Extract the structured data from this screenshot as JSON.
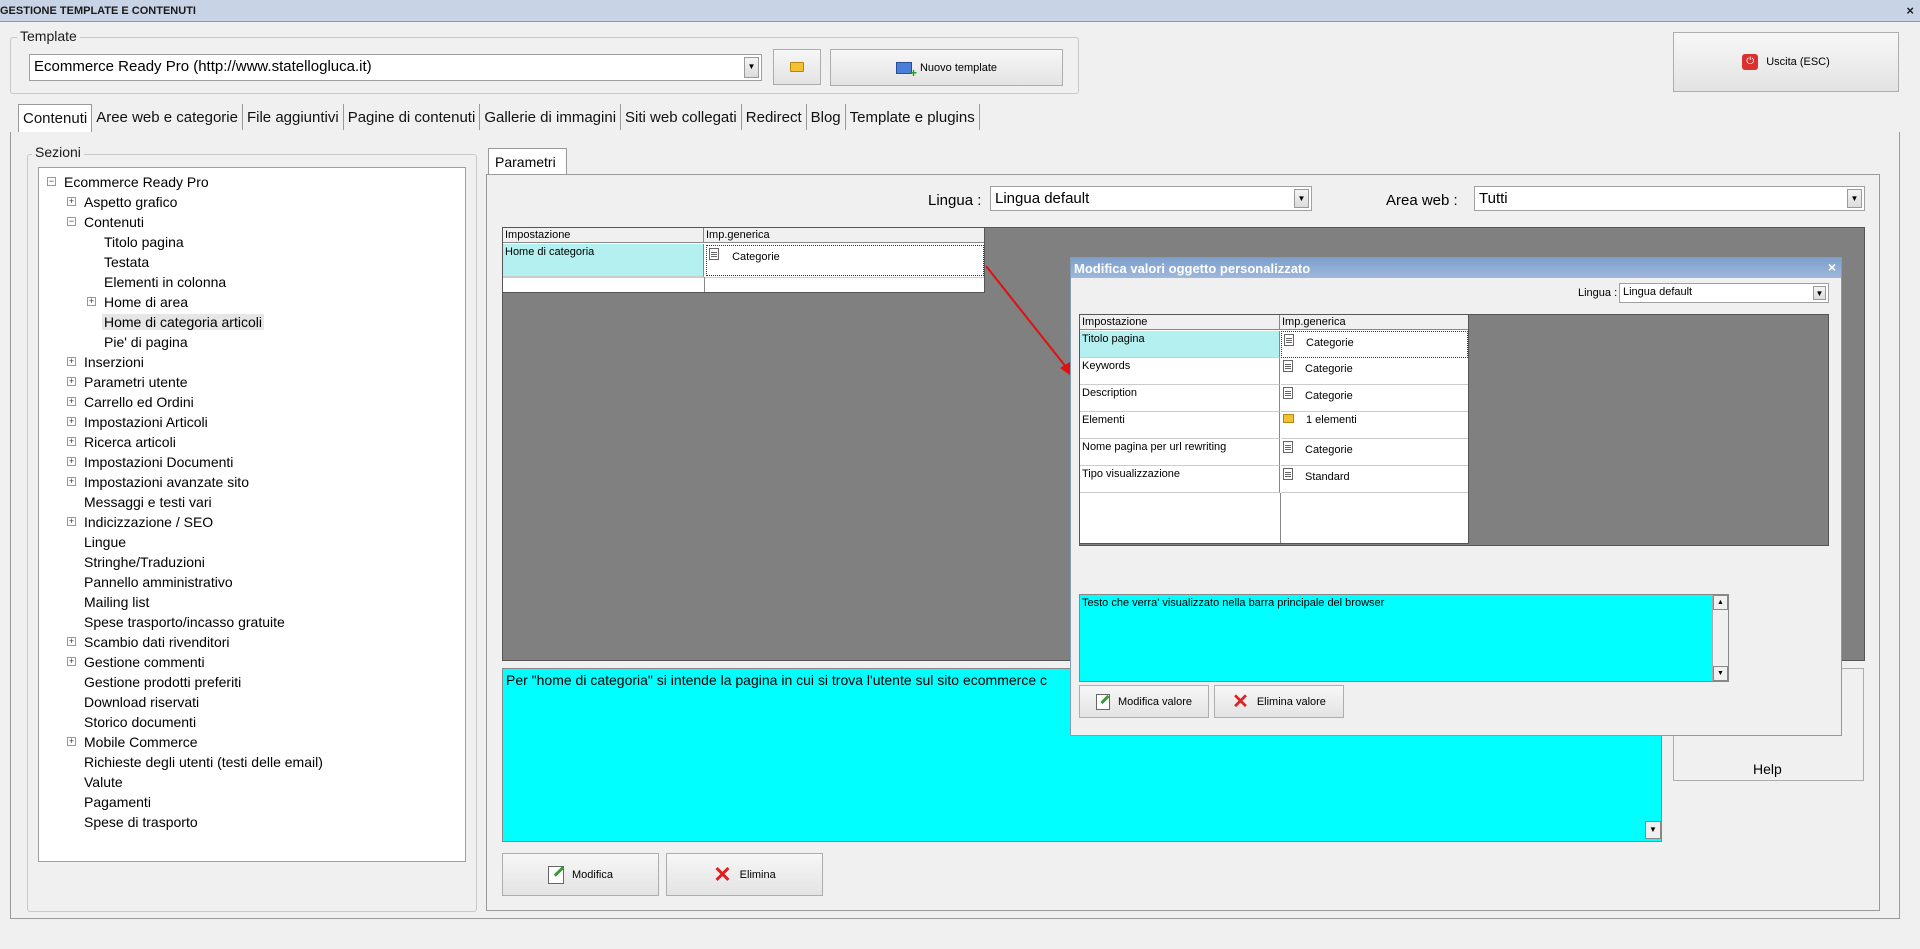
{
  "window": {
    "title": "GESTIONE TEMPLATE E CONTENUTI",
    "close_glyph": "×"
  },
  "template_group": {
    "legend": "Template",
    "selected": "Ecommerce Ready Pro (http://www.statellogluca.it)",
    "new_button": "Nuovo template"
  },
  "exit_button": "Uscita (ESC)",
  "tabs": [
    "Contenuti",
    "Aree web e categorie",
    "File aggiuntivi",
    "Pagine di contenuti",
    "Gallerie di immagini",
    "Siti web collegati",
    "Redirect",
    "Blog",
    "Template e plugins"
  ],
  "sections": {
    "legend": "Sezioni",
    "tree": [
      {
        "label": "Ecommerce Ready Pro",
        "level": 0,
        "toggle": "−"
      },
      {
        "label": "Aspetto grafico",
        "level": 1,
        "toggle": "+"
      },
      {
        "label": "Contenuti",
        "level": 1,
        "toggle": "−"
      },
      {
        "label": "Titolo pagina",
        "level": 2,
        "toggle": ""
      },
      {
        "label": "Testata",
        "level": 2,
        "toggle": ""
      },
      {
        "label": "Elementi in colonna",
        "level": 2,
        "toggle": ""
      },
      {
        "label": "Home di area",
        "level": 2,
        "toggle": "+"
      },
      {
        "label": "Home di categoria articoli",
        "level": 2,
        "toggle": "",
        "selected": true
      },
      {
        "label": "Pie' di pagina",
        "level": 2,
        "toggle": ""
      },
      {
        "label": "Inserzioni",
        "level": 1,
        "toggle": "+"
      },
      {
        "label": "Parametri utente",
        "level": 1,
        "toggle": "+"
      },
      {
        "label": "Carrello ed Ordini",
        "level": 1,
        "toggle": "+"
      },
      {
        "label": "Impostazioni Articoli",
        "level": 1,
        "toggle": "+"
      },
      {
        "label": "Ricerca articoli",
        "level": 1,
        "toggle": "+"
      },
      {
        "label": "Impostazioni Documenti",
        "level": 1,
        "toggle": "+"
      },
      {
        "label": "Impostazioni avanzate sito",
        "level": 1,
        "toggle": "+"
      },
      {
        "label": "Messaggi e testi vari",
        "level": 1,
        "toggle": ""
      },
      {
        "label": "Indicizzazione / SEO",
        "level": 1,
        "toggle": "+"
      },
      {
        "label": "Lingue",
        "level": 1,
        "toggle": ""
      },
      {
        "label": "Stringhe/Traduzioni",
        "level": 1,
        "toggle": ""
      },
      {
        "label": "Pannello amministrativo",
        "level": 1,
        "toggle": ""
      },
      {
        "label": "Mailing list",
        "level": 1,
        "toggle": ""
      },
      {
        "label": "Spese trasporto/incasso gratuite",
        "level": 1,
        "toggle": ""
      },
      {
        "label": "Scambio dati rivenditori",
        "level": 1,
        "toggle": "+"
      },
      {
        "label": "Gestione commenti",
        "level": 1,
        "toggle": "+"
      },
      {
        "label": "Gestione prodotti preferiti",
        "level": 1,
        "toggle": ""
      },
      {
        "label": "Download riservati",
        "level": 1,
        "toggle": ""
      },
      {
        "label": "Storico documenti",
        "level": 1,
        "toggle": ""
      },
      {
        "label": "Mobile Commerce",
        "level": 1,
        "toggle": "+"
      },
      {
        "label": "Richieste degli utenti (testi delle email)",
        "level": 1,
        "toggle": ""
      },
      {
        "label": "Valute",
        "level": 1,
        "toggle": ""
      },
      {
        "label": "Pagamenti",
        "level": 1,
        "toggle": ""
      },
      {
        "label": "Spese di trasporto",
        "level": 1,
        "toggle": ""
      }
    ]
  },
  "params": {
    "tab": "Parametri",
    "lingua_label": "Lingua :",
    "lingua_value": "Lingua default",
    "area_label": "Area web :",
    "area_value": "Tutti",
    "grid": {
      "col1": "Impostazione",
      "col2": "Imp.generica",
      "row_setting": "Home di categoria",
      "row_value": "Categorie"
    },
    "description": "Per \"home di categoria\" si intende la pagina in cui si trova l'utente sul sito ecommerce c",
    "modify_button": "Modifica",
    "delete_button": "Elimina",
    "help_button": "Help"
  },
  "dialog": {
    "title": "Modifica valori oggetto personalizzato",
    "lingua_label": "Lingua :",
    "lingua_value": "Lingua default",
    "col1": "Impostazione",
    "col2": "Imp.generica",
    "rows": [
      {
        "setting": "Titolo pagina",
        "value": "Categorie",
        "icon": "doc-icon"
      },
      {
        "setting": "Keywords",
        "value": "Categorie",
        "icon": "doc-icon"
      },
      {
        "setting": "Description",
        "value": "Categorie",
        "icon": "doc-icon"
      },
      {
        "setting": "Elementi",
        "value": "1 elementi",
        "icon": "folder-icon"
      },
      {
        "setting": "Nome pagina per url rewriting",
        "value": "Categorie",
        "icon": "doc-icon"
      },
      {
        "setting": "Tipo visualizzazione",
        "value": "Standard",
        "icon": "doc-icon"
      }
    ],
    "description": "Testo che verra' visualizzato nella barra principale del browser",
    "modify_button": "Modifica valore",
    "delete_button": "Elimina valore"
  }
}
